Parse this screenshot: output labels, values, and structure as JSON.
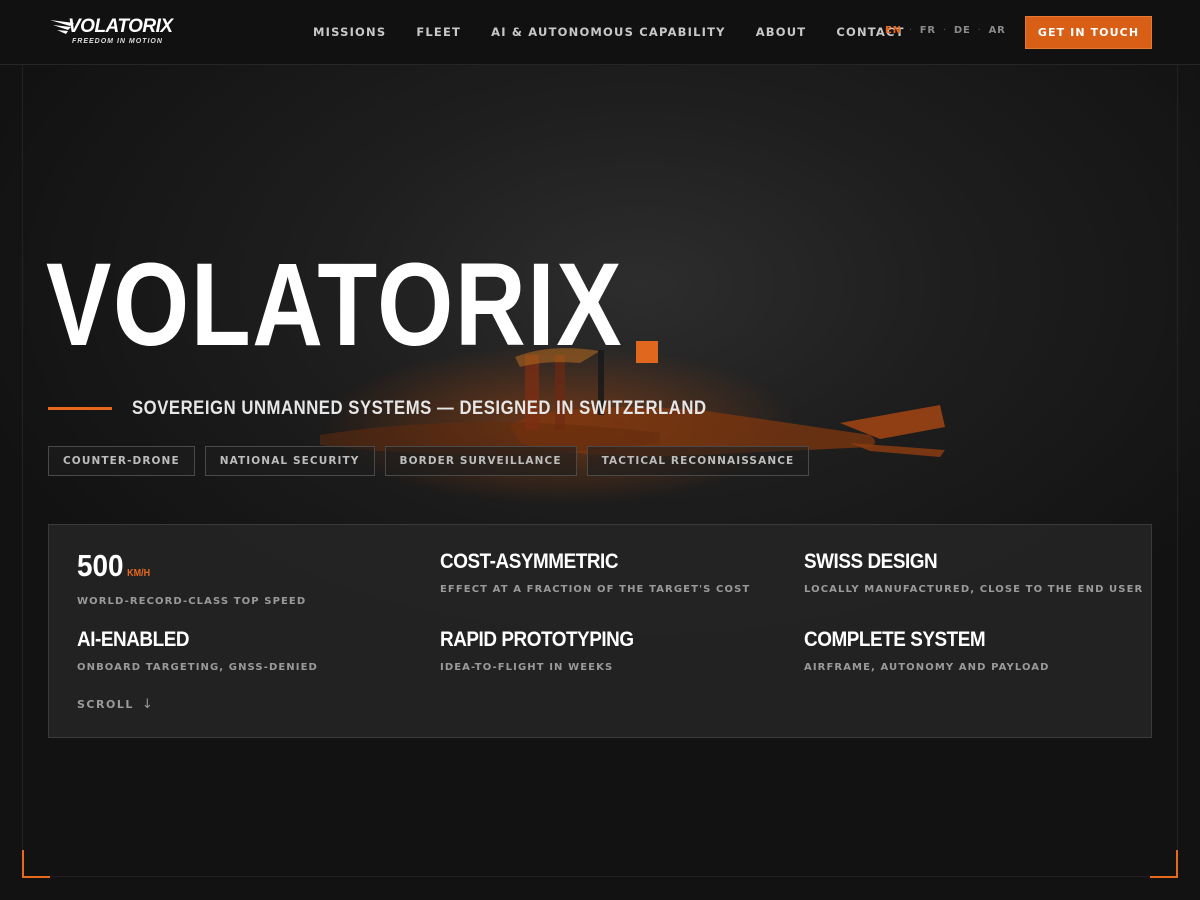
{
  "header": {
    "logo": {
      "wordmark": "VOLATORIX",
      "tagline": "FREEDOM IN MOTION"
    },
    "nav": [
      "MISSIONS",
      "FLEET",
      "AI & AUTONOMOUS CAPABILITY",
      "ABOUT",
      "CONTACT"
    ],
    "languages": [
      {
        "code": "EN",
        "active": true
      },
      {
        "code": "FR",
        "active": false
      },
      {
        "code": "DE",
        "active": false
      },
      {
        "code": "AR",
        "active": false
      }
    ],
    "language_separator": "·",
    "cta_label": "GET IN TOUCH"
  },
  "hero": {
    "title": "VOLATORIX",
    "subtitle": "SOVEREIGN UNMANNED SYSTEMS — DESIGNED IN SWITZERLAND",
    "tags": [
      "COUNTER-DRONE",
      "NATIONAL SECURITY",
      "BORDER SURVEILLANCE",
      "TACTICAL RECONNAISSANCE"
    ],
    "stats": [
      {
        "value": "500",
        "unit": "KM/H",
        "description": "WORLD-RECORD-CLASS TOP SPEED"
      },
      {
        "value": "COST-ASYMMETRIC",
        "unit": "",
        "description": "EFFECT AT A FRACTION OF THE TARGET'S COST"
      },
      {
        "value": "SWISS DESIGN",
        "unit": "",
        "description": "LOCALLY MANUFACTURED, CLOSE TO THE END USER"
      },
      {
        "value": "AI-ENABLED",
        "unit": "",
        "description": "ONBOARD TARGETING, GNSS-DENIED"
      },
      {
        "value": "RAPID PROTOTYPING",
        "unit": "",
        "description": "IDEA-TO-FLIGHT IN WEEKS"
      },
      {
        "value": "COMPLETE SYSTEM",
        "unit": "",
        "description": "AIRFRAME, AUTONOMY AND PAYLOAD"
      }
    ],
    "scroll_label": "SCROLL",
    "scroll_arrow": "↓"
  },
  "colors": {
    "accent": "#e8691c",
    "background": "#0c0c0c",
    "header": "#111111"
  },
  "icons": {
    "logo": "wing-logo-icon",
    "scroll": "arrow-down-icon",
    "background": "drone-image"
  }
}
